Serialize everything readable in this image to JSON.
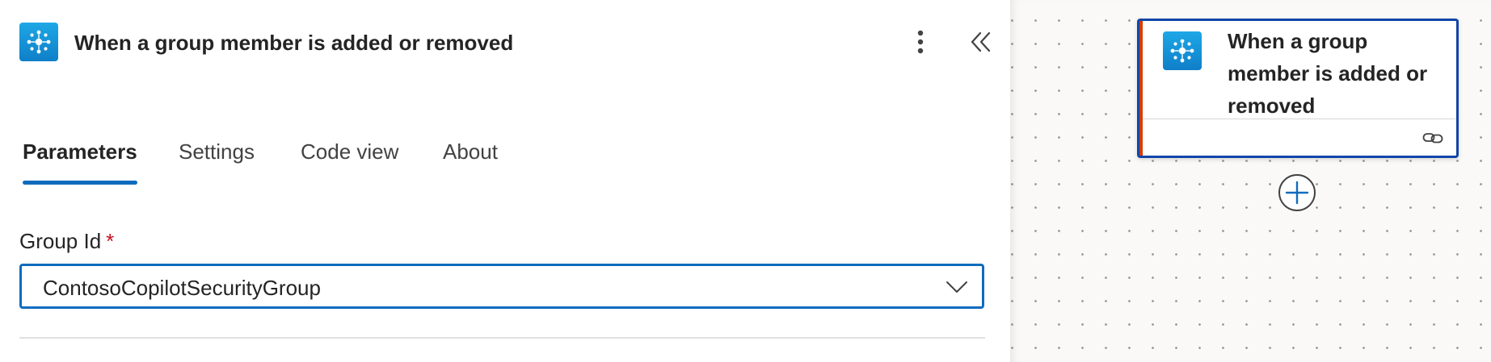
{
  "panel": {
    "title": "When a group member is added or removed",
    "icon": "microsoft-entra-groups-icon",
    "more_icon": "more-vertical-icon",
    "collapse_icon": "double-chevron-left-icon",
    "tabs": [
      {
        "label": "Parameters",
        "active": true
      },
      {
        "label": "Settings",
        "active": false
      },
      {
        "label": "Code view",
        "active": false
      },
      {
        "label": "About",
        "active": false
      }
    ],
    "field": {
      "label": "Group Id",
      "required_mark": "*",
      "value": "ContosoCopilotSecurityGroup",
      "chevron_icon": "chevron-down-icon"
    }
  },
  "canvas": {
    "card": {
      "title": "When a group member is added or removed",
      "icon": "microsoft-entra-groups-icon",
      "link_icon": "link-icon"
    },
    "add_icon": "add-circle-icon"
  },
  "colors": {
    "accent": "#0f6cbd",
    "card_border": "#1145a8",
    "card_accent": "#d83b01",
    "icon_bg": "#1593d8",
    "required": "#c50f1f"
  }
}
